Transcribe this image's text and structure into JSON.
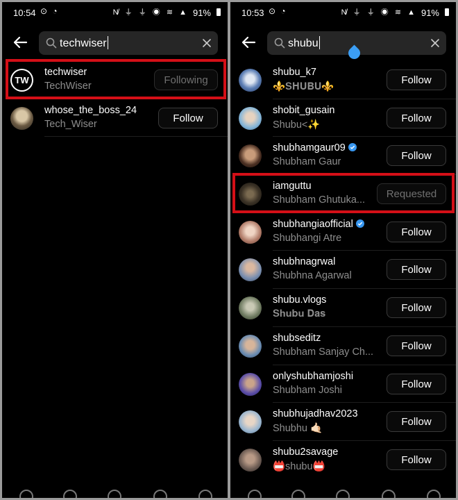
{
  "left": {
    "status": {
      "time": "10:54",
      "left_icons": "⊙ ◔",
      "right_icons": "N̸ ⏚ ⏚ ◉ ≋ ▲",
      "battery": "91%"
    },
    "search": {
      "query": "techwiser",
      "clear_icon": "close-icon"
    },
    "results": [
      {
        "username": "techwiser",
        "fullname": "TechWiser",
        "button": "Following",
        "avatar_text": "TW",
        "verified": false
      },
      {
        "username": "whose_the_boss_24",
        "fullname": "Tech_Wiser",
        "button": "Follow",
        "verified": false
      }
    ]
  },
  "right": {
    "status": {
      "time": "10:53",
      "left_icons": "⊙ ◔",
      "right_icons": "N̸ ⏚ ⏚ ◉ ≋ ▲",
      "battery": "91%"
    },
    "search": {
      "query": "shubu",
      "clear_icon": "close-icon"
    },
    "results": [
      {
        "username": "shubu_k7",
        "fullname": "⚜️𝐒𝐇𝐔𝐁𝐔⚜️",
        "button": "Follow",
        "verified": false
      },
      {
        "username": "shobit_gusain",
        "fullname": "Shubu<✨",
        "button": "Follow",
        "verified": false
      },
      {
        "username": "shubhamgaur09",
        "fullname": "Shubham Gaur",
        "button": "Follow",
        "verified": true
      },
      {
        "username": "iamguttu",
        "fullname": "Shubham Ghutuka...",
        "button": "Requested",
        "verified": false
      },
      {
        "username": "shubhangiaofficial",
        "fullname": "Shubhangi Atre",
        "button": "Follow",
        "verified": true
      },
      {
        "username": "shubhnagrwal",
        "fullname": "Shubhna Agarwal",
        "button": "Follow",
        "verified": false
      },
      {
        "username": "shubu.vlogs",
        "fullname": "𝐒𝐡𝐮𝐛𝐮 𝐃𝐚𝐬",
        "button": "Follow",
        "verified": false
      },
      {
        "username": "shubseditz",
        "fullname": "Shubham Sanjay Ch...",
        "button": "Follow",
        "verified": false
      },
      {
        "username": "onlyshubhamjoshi",
        "fullname": "Shubham Joshi",
        "button": "Follow",
        "verified": false
      },
      {
        "username": "shubhujadhav2023",
        "fullname": "Shubhu 🤙🏻",
        "button": "Follow",
        "verified": false
      },
      {
        "username": "shubu2savage",
        "fullname": "📛shubu📛",
        "button": "Follow",
        "verified": false
      }
    ]
  },
  "colors": {
    "highlight": "#d40f17",
    "verified": "#3897f0",
    "background": "#000000",
    "search_bg": "#262626"
  }
}
